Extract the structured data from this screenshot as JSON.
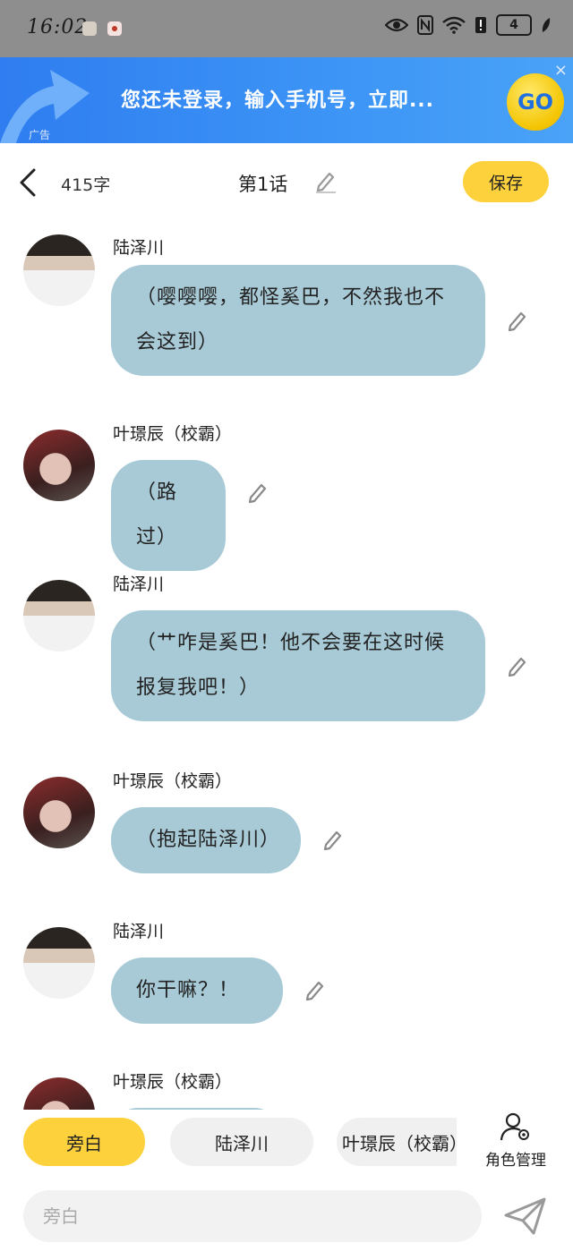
{
  "status_bar": {
    "time": "16:02",
    "battery": "4"
  },
  "ad": {
    "text": "您还未登录，输入手机号，立即...",
    "go_label": "GO",
    "label": "广告",
    "close": "×"
  },
  "header": {
    "word_count": "415字",
    "chapter_title": "第1话",
    "save_label": "保存"
  },
  "messages": [
    {
      "speaker": "陆泽川",
      "avatar": "a",
      "text": "（嘤嘤嘤，都怪奚巴，不然我也不会这到）"
    },
    {
      "speaker": "叶璟辰（校霸）",
      "avatar": "b",
      "text": "（路过）"
    },
    {
      "speaker": "陆泽川",
      "avatar": "a",
      "text": "（艹咋是奚巴！他不会要在这时候报复我吧！）"
    },
    {
      "speaker": "叶璟辰（校霸）",
      "avatar": "b",
      "text": "（抱起陆泽川）"
    },
    {
      "speaker": "陆泽川",
      "avatar": "a",
      "text": "你干嘛？！"
    },
    {
      "speaker": "叶璟辰（校霸）",
      "avatar": "b",
      "text": ""
    }
  ],
  "characters": [
    {
      "label": "旁白",
      "active": true
    },
    {
      "label": "陆泽川",
      "active": false
    },
    {
      "label": "叶璟辰（校霸）",
      "active": false
    }
  ],
  "role_manager_label": "角色管理",
  "input": {
    "placeholder": "旁白"
  },
  "colors": {
    "accent": "#fdd13c",
    "bubble": "#a8cad6",
    "ad_blue": "#3d95f6"
  },
  "icons": {
    "back": "chevron-left-icon",
    "edit": "pencil-icon",
    "role": "user-gear-icon",
    "send": "paper-plane-icon"
  }
}
